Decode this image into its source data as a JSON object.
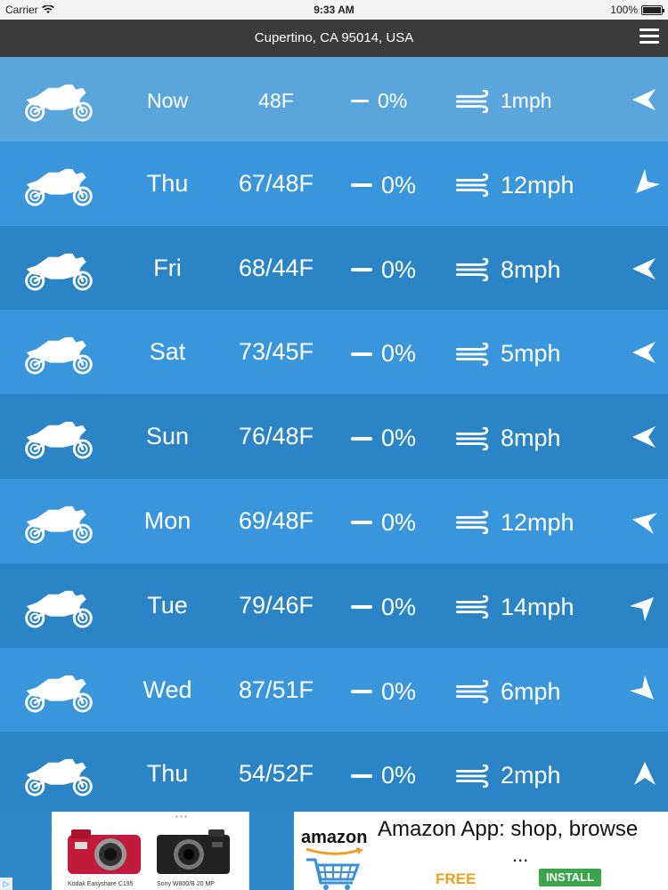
{
  "status_bar": {
    "carrier": "Carrier",
    "time": "9:33 AM",
    "battery": "100%"
  },
  "nav": {
    "title": "Cupertino, CA 95014, USA",
    "menu_icon": "hamburger-menu-icon"
  },
  "forecast": [
    {
      "day": "Now",
      "temp": "48F",
      "precip": "0%",
      "wind": "1mph",
      "wind_dir_deg": 0
    },
    {
      "day": "Thu",
      "temp": "67/48F",
      "precip": "0%",
      "wind": "12mph",
      "wind_dir_deg": 315
    },
    {
      "day": "Fri",
      "temp": "68/44F",
      "precip": "0%",
      "wind": "8mph",
      "wind_dir_deg": 0
    },
    {
      "day": "Sat",
      "temp": "73/45F",
      "precip": "0%",
      "wind": "5mph",
      "wind_dir_deg": 0
    },
    {
      "day": "Sun",
      "temp": "76/48F",
      "precip": "0%",
      "wind": "8mph",
      "wind_dir_deg": 0
    },
    {
      "day": "Mon",
      "temp": "69/48F",
      "precip": "0%",
      "wind": "12mph",
      "wind_dir_deg": 10
    },
    {
      "day": "Tue",
      "temp": "79/46F",
      "precip": "0%",
      "wind": "14mph",
      "wind_dir_deg": 135
    },
    {
      "day": "Wed",
      "temp": "87/51F",
      "precip": "0%",
      "wind": "6mph",
      "wind_dir_deg": 225
    },
    {
      "day": "Thu",
      "temp": "54/52F",
      "precip": "0%",
      "wind": "2mph",
      "wind_dir_deg": 90
    }
  ],
  "ad": {
    "product_1_caption": "Kodak Easyshare C195",
    "product_2_caption": "Sony W800/B 20 MP",
    "brand": "amazon",
    "headline": "Amazon App: shop, browse",
    "ellipsis": "...",
    "free_label": "FREE",
    "install_label": "INSTALL"
  },
  "colors": {
    "nav_bg": "#3b3b3b",
    "row_now": "#5aa6dc",
    "row_light": "#3a96dc",
    "row_dark": "#2a84c6"
  }
}
